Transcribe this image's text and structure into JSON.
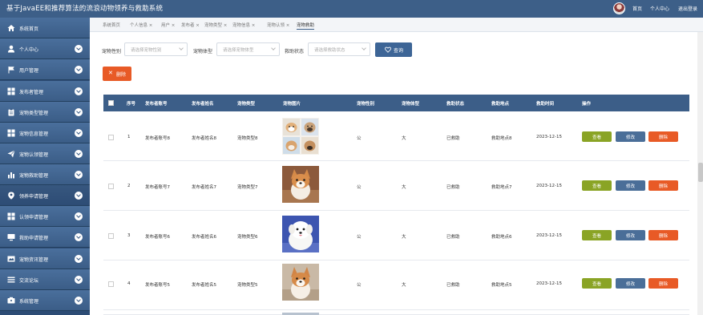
{
  "app": {
    "title": "基于JavaEE和推荐算法的流浪动物领养与救助系统",
    "nav": {
      "home": "首页",
      "profile": "个人中心",
      "logout": "退出登录"
    }
  },
  "sidebar": {
    "items": [
      {
        "label": "系统首页",
        "icon": "home-icon"
      },
      {
        "label": "个人中心",
        "icon": "user-icon"
      },
      {
        "label": "用户管理",
        "icon": "flag-icon"
      },
      {
        "label": "发布者管理",
        "icon": "grid-icon"
      },
      {
        "label": "宠物类型管理",
        "icon": "clipboard-icon"
      },
      {
        "label": "宠物信息管理",
        "icon": "grid-icon"
      },
      {
        "label": "宠物认领管理",
        "icon": "paper-plane-icon"
      },
      {
        "label": "宠物救助管理",
        "icon": "bar-chart-icon"
      },
      {
        "label": "领养申请管理",
        "icon": "location-pin-icon"
      },
      {
        "label": "认领申请管理",
        "icon": "grid-icon"
      },
      {
        "label": "救助申请管理",
        "icon": "monitor-icon"
      },
      {
        "label": "宠物资讯管理",
        "icon": "news-icon"
      },
      {
        "label": "交流论坛",
        "icon": "list-icon"
      },
      {
        "label": "系统管理",
        "icon": "settings-icon"
      }
    ]
  },
  "tabs": [
    "系统首页",
    "个人信息 ×",
    "用户 ×",
    "发布者 ×",
    "宠物类型 ×",
    "宠物信息 ×",
    "宠物认领 ×",
    "宠物救助"
  ],
  "filters": {
    "gender": {
      "label": "宠物性别",
      "placeholder": "请选择宠物性别"
    },
    "size": {
      "label": "宠物体型",
      "placeholder": "请选择宠物体型"
    },
    "status": {
      "label": "救助状态",
      "placeholder": "请选择救助状态"
    },
    "search_label": "查询",
    "delete_label": "删除"
  },
  "table": {
    "headers": [
      "序号",
      "发布者账号",
      "发布者姓名",
      "宠物类型",
      "宠物图片",
      "宠物性别",
      "宠物体型",
      "救助状态",
      "救助地点",
      "救助时间",
      "操作"
    ],
    "rows": [
      {
        "index": "1",
        "account": "发布者账号8",
        "name": "发布者姓名8",
        "type": "宠物类型8",
        "gender": "公",
        "size": "大",
        "status": "已救助",
        "place": "救助地点8",
        "date": "2023-12-15"
      },
      {
        "index": "2",
        "account": "发布者账号7",
        "name": "发布者姓名7",
        "type": "宠物类型7",
        "gender": "公",
        "size": "大",
        "status": "已救助",
        "place": "救助地点7",
        "date": "2023-12-15"
      },
      {
        "index": "3",
        "account": "发布者账号6",
        "name": "发布者姓名6",
        "type": "宠物类型6",
        "gender": "公",
        "size": "大",
        "status": "已救助",
        "place": "救助地点6",
        "date": "2023-12-15"
      },
      {
        "index": "4",
        "account": "发布者账号5",
        "name": "发布者姓名5",
        "type": "宠物类型5",
        "gender": "公",
        "size": "大",
        "status": "已救助",
        "place": "救助地点5",
        "date": "2023-12-15"
      }
    ],
    "actions": {
      "view": "查看",
      "edit": "修改",
      "delete": "删除"
    }
  }
}
